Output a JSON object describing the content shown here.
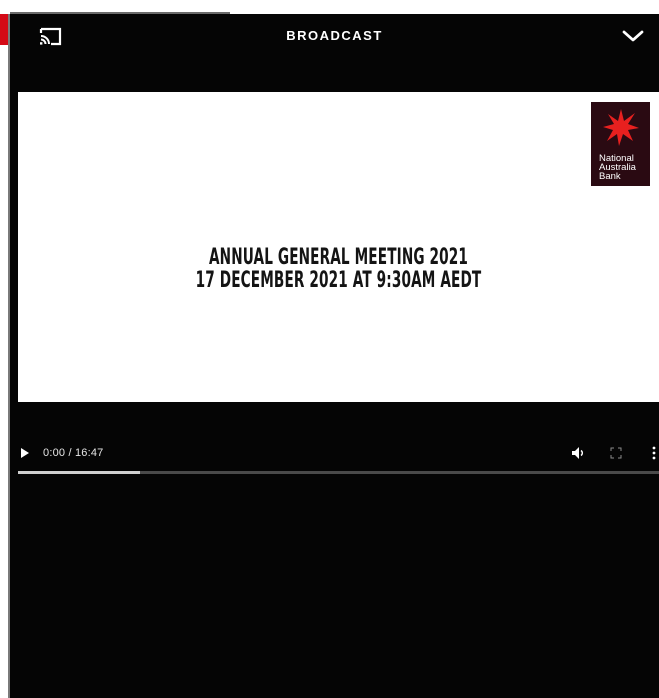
{
  "header": {
    "title": "BROADCAST"
  },
  "slide": {
    "logo_lines": [
      "National",
      "Australia",
      "Bank"
    ],
    "headline_line1": "ANNUAL GENERAL MEETING 2021",
    "headline_line2": "17 DECEMBER 2021 AT 9:30AM AEDT"
  },
  "controls": {
    "time": "0:00 / 16:47",
    "buffered_fraction": 0.19
  },
  "colors": {
    "accent": "#d40a16",
    "player_bg": "#050505",
    "logo_bg": "#2a0a12",
    "star": "#e8201f"
  },
  "icons": {
    "cast": "cast-icon",
    "collapse": "chevron-down-icon",
    "play": "play-icon",
    "volume": "volume-icon",
    "fullscreen": "fullscreen-icon",
    "more": "more-vertical-icon"
  }
}
